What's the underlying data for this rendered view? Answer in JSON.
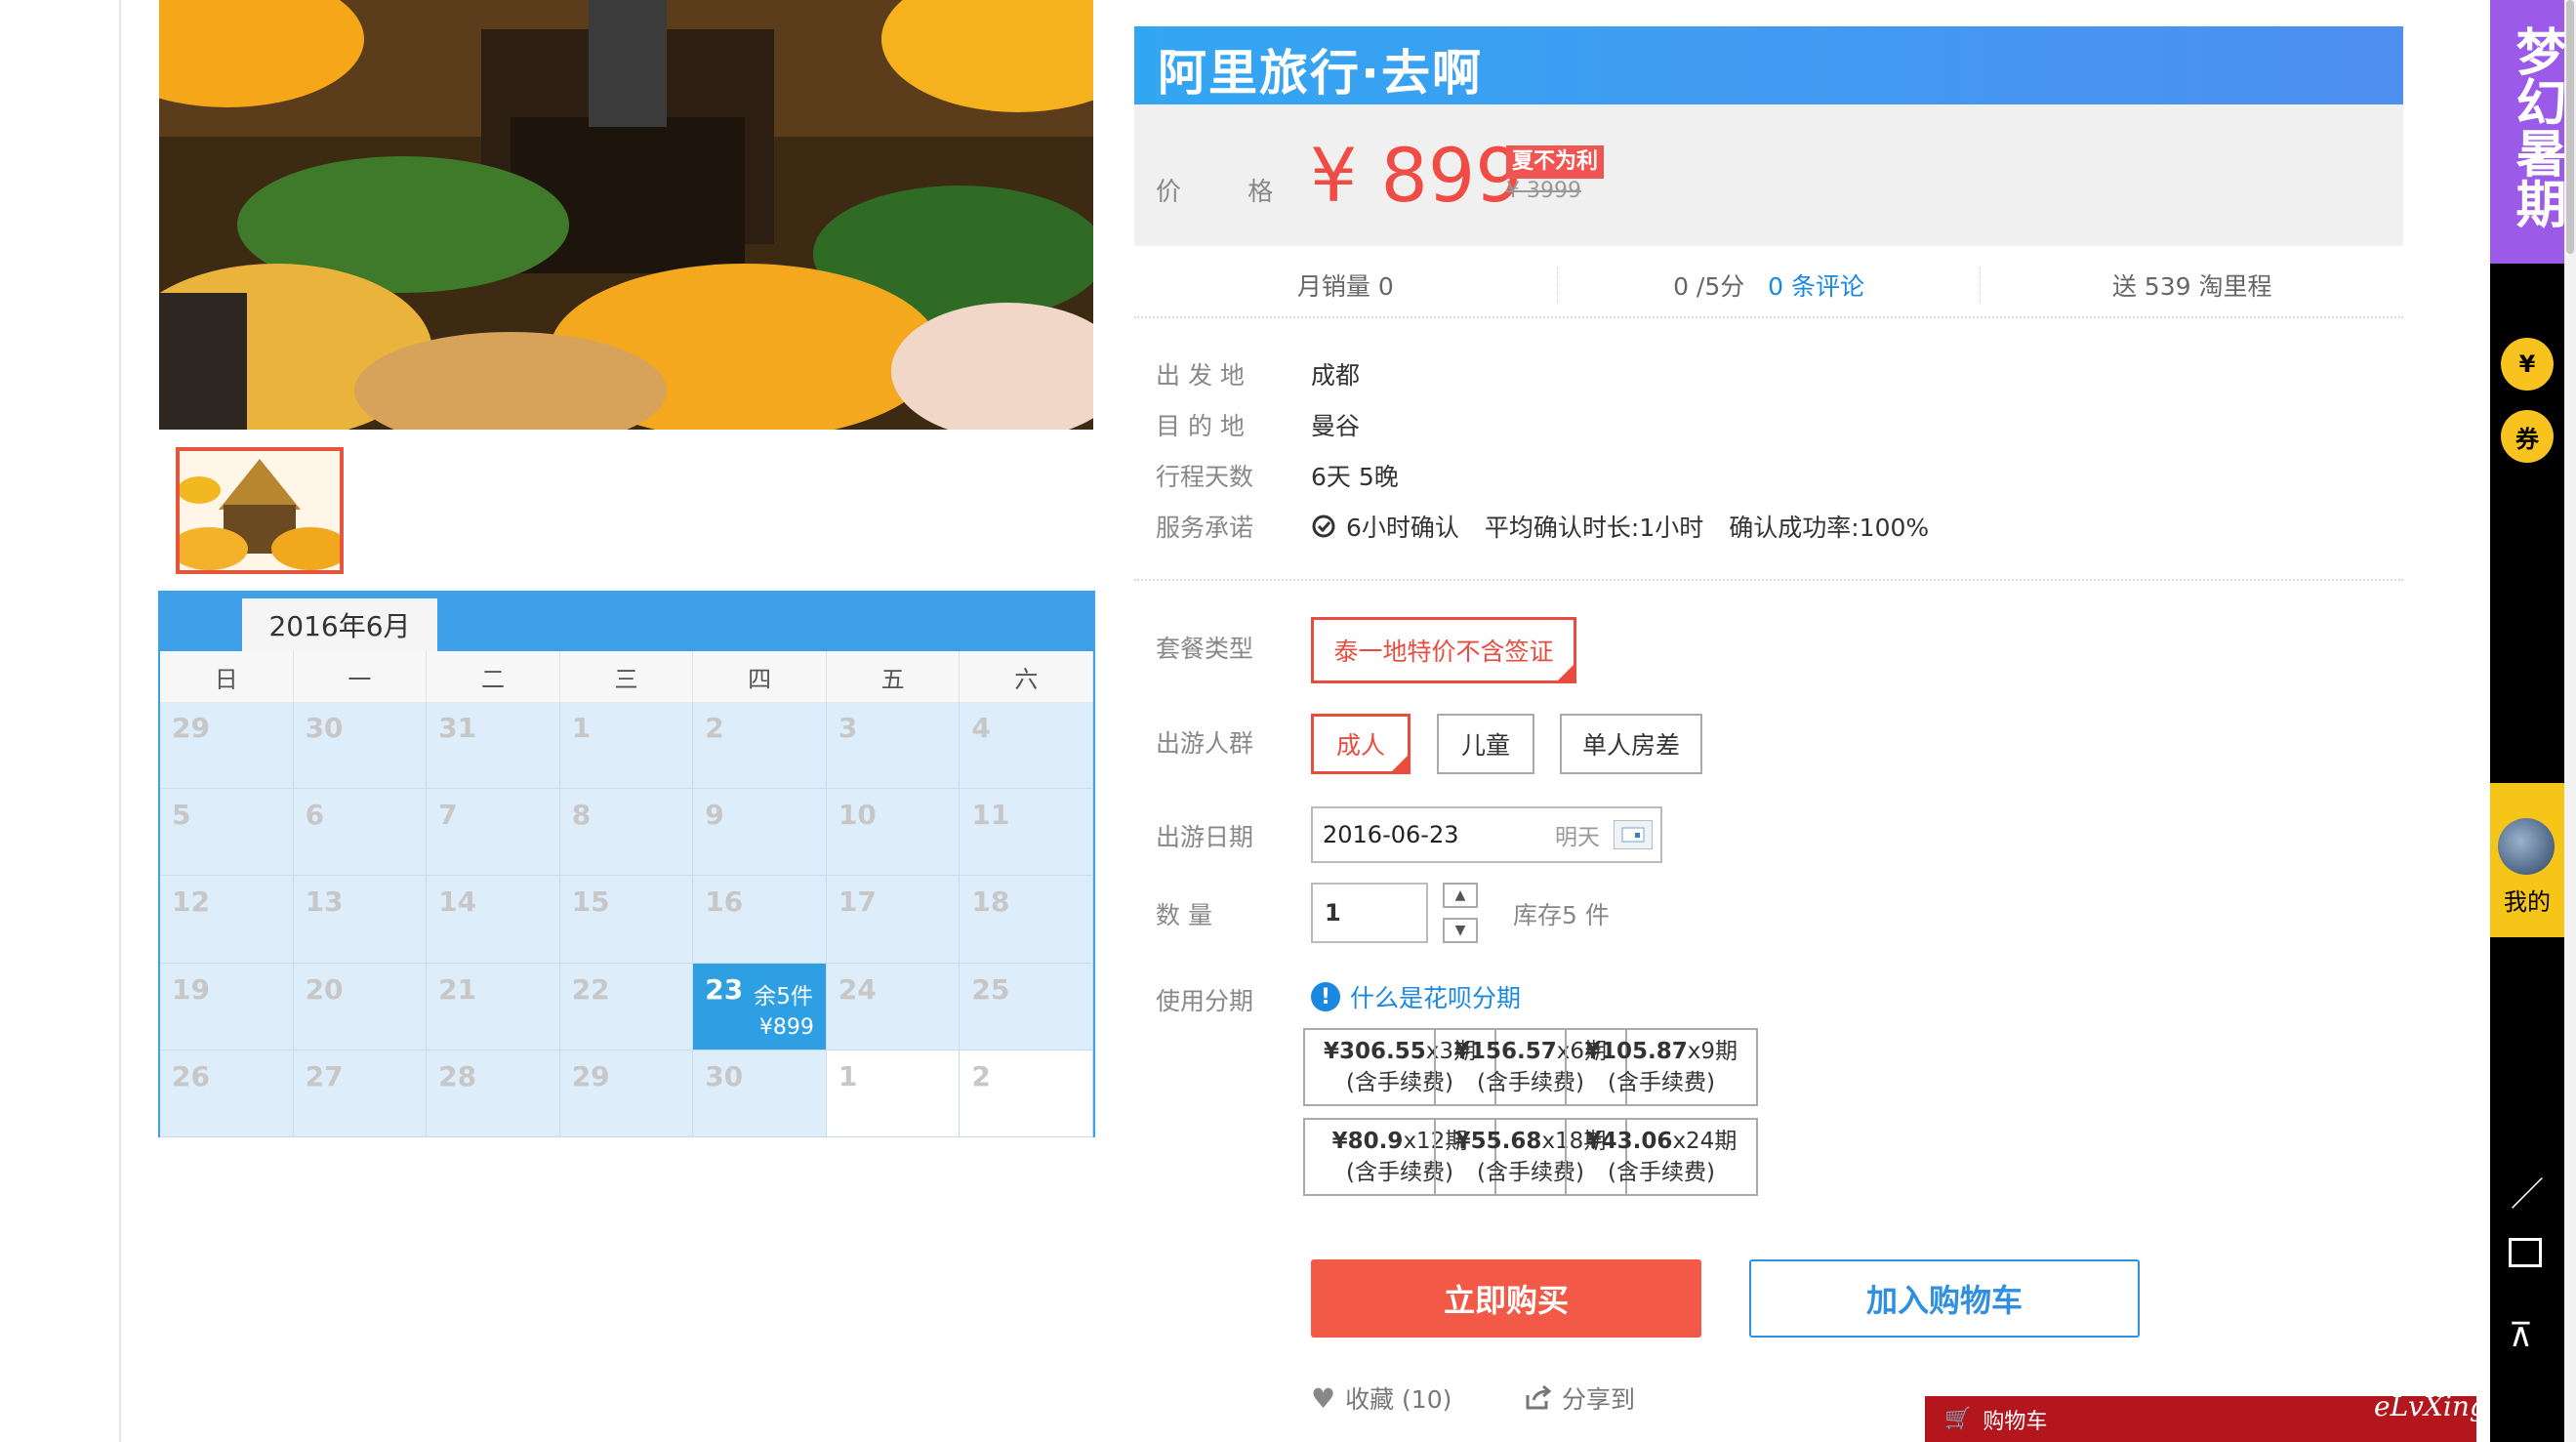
{
  "brand": {
    "title": "阿里旅行·去啊"
  },
  "price": {
    "label": "价 格",
    "value": "¥ 899",
    "promo_badge": "夏不为利",
    "original": "¥ 3999"
  },
  "stats": {
    "monthly_sales": "月销量 0",
    "rating": "0 /5分",
    "reviews": "0 条评论",
    "mileage": "送 539 淘里程"
  },
  "info": [
    {
      "label": "出 发 地",
      "value": "成都"
    },
    {
      "label": "目 的 地",
      "value": "曼谷"
    },
    {
      "label": "行程天数",
      "value": "6天 5晚"
    }
  ],
  "service": {
    "label": "服务承诺",
    "confirm": "6小时确认",
    "avg_time": "平均确认时长:1小时",
    "success_rate": "确认成功率:100%"
  },
  "package": {
    "label": "套餐类型",
    "selected": "泰一地特价不含签证"
  },
  "travelers": {
    "label": "出游人群",
    "options": [
      "成人",
      "儿童",
      "单人房差"
    ],
    "selected_index": 0
  },
  "travel_date": {
    "label": "出游日期",
    "value": "2016-06-23",
    "hint": "明天"
  },
  "quantity": {
    "label": "数 量",
    "value": "1",
    "stock": "库存5 件"
  },
  "installment": {
    "label": "使用分期",
    "help_link": "什么是花呗分期",
    "fee_note": "(含手续费)",
    "plans": [
      {
        "amount": "¥306.55",
        "term": "x3期"
      },
      {
        "amount": "¥156.57",
        "term": "x6期"
      },
      {
        "amount": "¥105.87",
        "term": "x9期"
      },
      {
        "amount": "¥80.9",
        "term": "x12期"
      },
      {
        "amount": "¥55.68",
        "term": "x18期"
      },
      {
        "amount": "¥43.06",
        "term": "x24期"
      }
    ]
  },
  "actions": {
    "buy_now": "立即购买",
    "add_to_cart": "加入购物车",
    "favorite": "收藏 (10)",
    "share": "分享到"
  },
  "calendar": {
    "month_title": "2016年6月",
    "weekdays": [
      "日",
      "一",
      "二",
      "三",
      "四",
      "五",
      "六"
    ],
    "days": [
      "29",
      "30",
      "31",
      "1",
      "2",
      "3",
      "4",
      "5",
      "6",
      "7",
      "8",
      "9",
      "10",
      "11",
      "12",
      "13",
      "14",
      "15",
      "16",
      "17",
      "18",
      "19",
      "20",
      "21",
      "22",
      "23",
      "24",
      "25",
      "26",
      "27",
      "28",
      "29",
      "30",
      "1",
      "2"
    ],
    "selected": {
      "day": "23",
      "stock": "余5件",
      "price": "¥899"
    }
  },
  "sidebar": {
    "promo": "梦幻暑期",
    "me_label": "我的",
    "mini_cart": "购物车"
  },
  "watermark": "eLvXing.net",
  "colors": {
    "accent_red": "#f25a47",
    "brand_blue": "#33a6f2",
    "calendar_blue": "#2e9fe3",
    "promo_purple": "#9b5be8",
    "sidebar_yellow": "#f8c31f"
  }
}
